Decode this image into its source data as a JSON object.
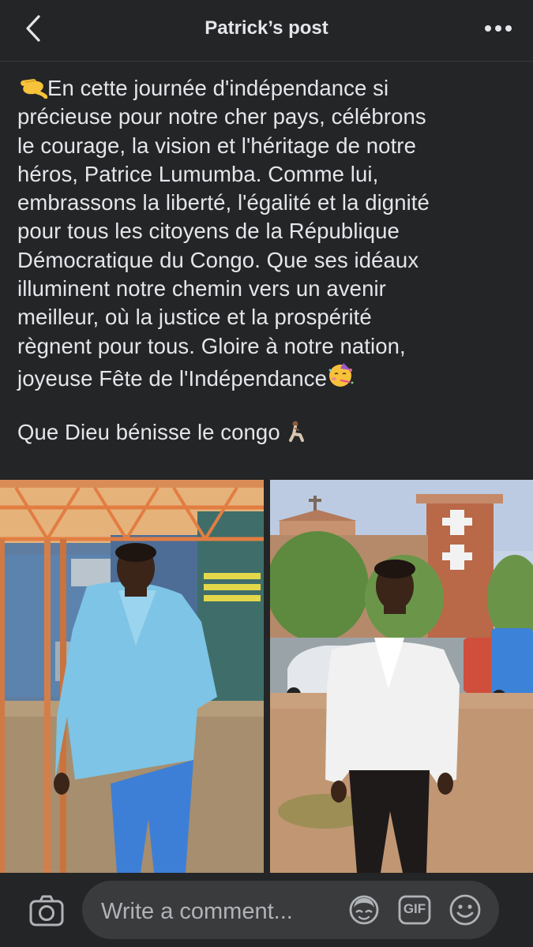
{
  "header": {
    "title": "Patrick’s post",
    "back_icon": "chevron-left-icon",
    "more_icon": "more-horizontal-icon"
  },
  "post": {
    "lines": [
      "En cette journée d'indépendance si",
      "précieuse pour notre cher pays, célébrons",
      "le courage, la vision et l'héritage de notre",
      "héros, Patrice Lumumba. Comme lui,",
      "embrassons la liberté, l'égalité et la dignité",
      "pour tous les citoyens de la République",
      "Démocratique du Congo. Que ses idéaux",
      "illuminent notre chemin vers un avenir",
      "meilleur, où la justice et la prospérité",
      "règnent pour tous. Gloire à notre nation,",
      "joyeuse Fête de l'Indépendance"
    ],
    "blessing": "Que Dieu bénisse le congo",
    "emojis": [
      "saluting-hand-emoji",
      "partying-face-emoji",
      "kneeling-person-emoji"
    ]
  },
  "photos": [
    {
      "subject": "man in light blue shirt under metal canopy"
    },
    {
      "subject": "man in white shirt in front of church"
    }
  ],
  "composer": {
    "placeholder": "Write a comment...",
    "gif_label": "GIF"
  },
  "colors": {
    "background": "#242526",
    "text": "#e4e6eb",
    "input_bg": "#3a3b3c",
    "muted": "#b0b3b8"
  }
}
